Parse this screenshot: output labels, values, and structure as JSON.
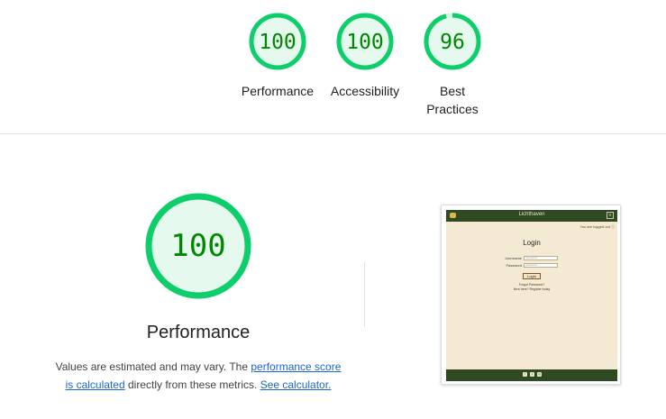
{
  "summary": {
    "gauges": [
      {
        "score": "100",
        "label": "Performance",
        "fraction": 1.0
      },
      {
        "score": "100",
        "label": "Accessibility",
        "fraction": 1.0
      },
      {
        "score": "96",
        "label": "Best Practices",
        "fraction": 0.96
      }
    ]
  },
  "performance": {
    "score": "100",
    "fraction": 1.0,
    "title": "Performance",
    "note_text_1": "Values are estimated and may vary. The ",
    "note_link_1": "performance score is calculated",
    "note_text_2": " directly from these metrics. ",
    "note_link_2": "See calculator."
  },
  "screenshot": {
    "brand": "Lichthaven",
    "menu": "≡",
    "status": "You are logged out ⓘ",
    "login_title": "Login",
    "username_label": "Username",
    "username_placeholder": "username",
    "password_label": "Password",
    "password_placeholder": "password",
    "login_button": "Login",
    "forgot_link": "Forgot Password?",
    "register_link": "New here? Register today",
    "social_icons": [
      "f",
      "t",
      "◎"
    ]
  },
  "colors": {
    "pass_green": "#0cce6b",
    "pass_text": "#008800",
    "pass_fill": "#e6f9ee",
    "link_blue": "#1967d2"
  }
}
